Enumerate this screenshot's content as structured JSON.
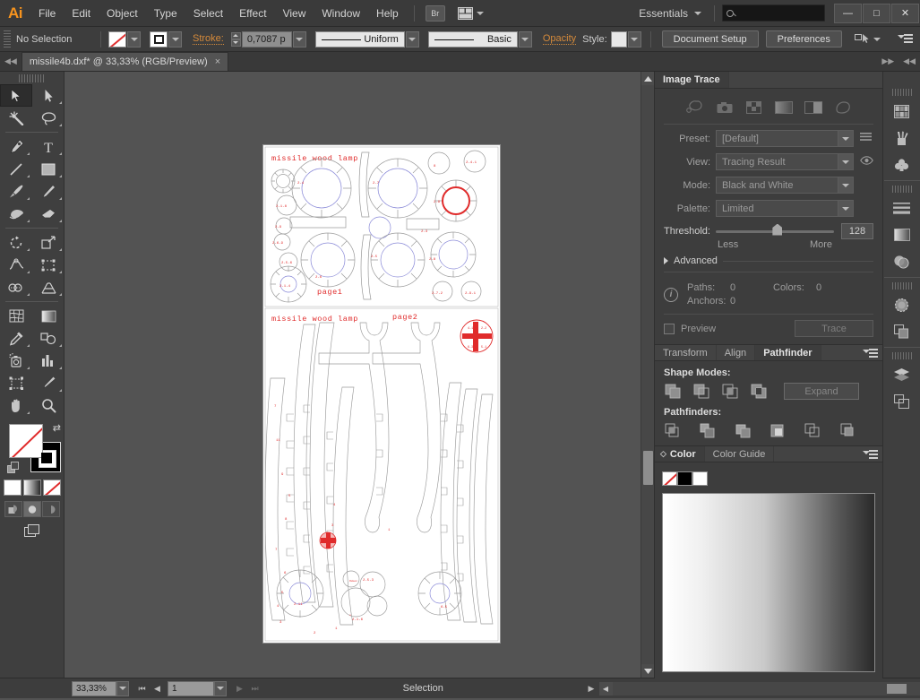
{
  "app": {
    "logo": "Ai",
    "menus": [
      "File",
      "Edit",
      "Object",
      "Type",
      "Select",
      "Effect",
      "View",
      "Window",
      "Help"
    ],
    "bridge_button": "Br",
    "workspace": "Essentials",
    "search_placeholder": "",
    "window_controls": {
      "minimize": "—",
      "maximize": "□",
      "close": "✕"
    }
  },
  "control_bar": {
    "selection_state": "No Selection",
    "stroke_label": "Stroke:",
    "stroke_weight": "0,7087 p",
    "profile": "Uniform",
    "brush": "Basic",
    "opacity_label": "Opacity",
    "style_label": "Style:",
    "document_setup": "Document Setup",
    "preferences": "Preferences"
  },
  "tab_bar": {
    "document_tab": "missile4b.dxf* @ 33,33% (RGB/Preview)",
    "close": "×"
  },
  "toolbox": {
    "tools": [
      {
        "name": "selection-tool",
        "selected": true
      },
      {
        "name": "direct-selection-tool",
        "selected": false
      },
      {
        "name": "magic-wand-tool",
        "selected": false
      },
      {
        "name": "lasso-tool",
        "selected": false
      },
      {
        "name": "pen-tool",
        "selected": false
      },
      {
        "name": "type-tool",
        "selected": false
      },
      {
        "name": "line-segment-tool",
        "selected": false
      },
      {
        "name": "rectangle-tool",
        "selected": false
      },
      {
        "name": "paintbrush-tool",
        "selected": false
      },
      {
        "name": "pencil-tool",
        "selected": false
      },
      {
        "name": "blob-brush-tool",
        "selected": false
      },
      {
        "name": "eraser-tool",
        "selected": false
      },
      {
        "name": "rotate-tool",
        "selected": false
      },
      {
        "name": "scale-tool",
        "selected": false
      },
      {
        "name": "width-tool",
        "selected": false
      },
      {
        "name": "free-transform-tool",
        "selected": false
      },
      {
        "name": "shape-builder-tool",
        "selected": false
      },
      {
        "name": "perspective-grid-tool",
        "selected": false
      },
      {
        "name": "mesh-tool",
        "selected": false
      },
      {
        "name": "gradient-tool",
        "selected": false
      },
      {
        "name": "eyedropper-tool",
        "selected": false
      },
      {
        "name": "blend-tool",
        "selected": false
      },
      {
        "name": "symbol-sprayer-tool",
        "selected": false
      },
      {
        "name": "column-graph-tool",
        "selected": false
      },
      {
        "name": "artboard-tool",
        "selected": false
      },
      {
        "name": "slice-tool",
        "selected": false
      },
      {
        "name": "hand-tool",
        "selected": false
      },
      {
        "name": "zoom-tool",
        "selected": false
      }
    ]
  },
  "image_trace": {
    "tab": "Image Trace",
    "mode_icons": [
      "auto-color-icon",
      "high-color-icon",
      "low-color-icon",
      "grayscale-icon",
      "black-and-white-icon",
      "outline-icon"
    ],
    "preset_label": "Preset:",
    "preset_value": "[Default]",
    "view_label": "View:",
    "view_value": "Tracing Result",
    "mode_label": "Mode:",
    "mode_value": "Black and White",
    "palette_label": "Palette:",
    "palette_value": "Limited",
    "threshold_label": "Threshold:",
    "threshold_value": "128",
    "threshold_less": "Less",
    "threshold_more": "More",
    "advanced_label": "Advanced",
    "paths_label": "Paths:",
    "paths_value": "0",
    "colors_label": "Colors:",
    "colors_value": "0",
    "anchors_label": "Anchors:",
    "anchors_value": "0",
    "preview_label": "Preview",
    "trace_button": "Trace"
  },
  "pathfinder": {
    "tabs": [
      "Transform",
      "Align",
      "Pathfinder"
    ],
    "active_tab": "Pathfinder",
    "shape_modes_label": "Shape Modes:",
    "shape_mode_icons": [
      "unite-icon",
      "minus-front-icon",
      "intersect-icon",
      "exclude-icon"
    ],
    "expand_button": "Expand",
    "pathfinders_label": "Pathfinders:",
    "pathfinder_icons": [
      "divide-icon",
      "trim-icon",
      "merge-icon",
      "crop-icon",
      "outline-icon",
      "minus-back-icon"
    ]
  },
  "color_panel": {
    "tabs": [
      "Color",
      "Color Guide"
    ],
    "active_tab": "Color",
    "swatches": [
      "none",
      "#000000",
      "#ffffff"
    ],
    "ramp_from": "#ffffff",
    "ramp_to": "#000000"
  },
  "right_rail": {
    "icons": [
      "swatches-icon",
      "brushes-icon",
      "symbols-icon",
      "stroke-icon",
      "gradient-icon",
      "transparency-icon",
      "appearance-icon",
      "graphic-styles-icon",
      "layers-icon",
      "artboards-icon"
    ]
  },
  "status_bar": {
    "zoom_level": "33,33%",
    "page_number": "1",
    "status_text": "Selection"
  },
  "artwork": {
    "page1_title": "missile  wood  lamp",
    "page1_label": "page1",
    "page2_title": "missile  wood  lamp",
    "page2_label": "page2",
    "stroke_color_red": "#e02b2b",
    "stroke_color_gray": "#999999",
    "stroke_color_blue": "#8a8ad8"
  }
}
